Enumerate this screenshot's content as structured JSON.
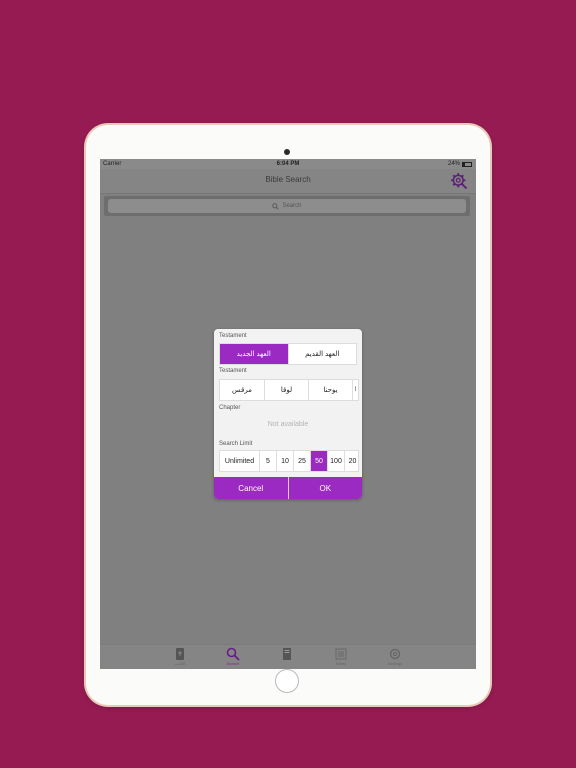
{
  "status": {
    "carrier": "Carrier",
    "time": "6:04 PM",
    "battery": "24%"
  },
  "header": {
    "title": "Bible Search"
  },
  "search": {
    "placeholder": "Search"
  },
  "tabs": [
    {
      "label": "الكتاب",
      "icon": "bible-icon",
      "active": false
    },
    {
      "label": "Search",
      "icon": "search-icon",
      "active": true
    },
    {
      "label": "",
      "icon": "bookmark-icon",
      "active": false
    },
    {
      "label": "Notes",
      "icon": "notes-icon",
      "active": false
    },
    {
      "label": "Settings",
      "icon": "settings-icon",
      "active": false
    }
  ],
  "dialog": {
    "testament_label": "Testament",
    "testament_options": [
      "العهد الجديد",
      "العهد القديم"
    ],
    "testament_selected": "العهد الجديد",
    "book_label": "Testament",
    "book_options": [
      "مرقس",
      "لوقا",
      "يوحنا",
      "أ"
    ],
    "chapter_label": "Chapter",
    "chapter_value": "Not available",
    "limit_label": "Search Limit",
    "limit_options": [
      "Unlimited",
      "5",
      "10",
      "25",
      "50",
      "100",
      "20"
    ],
    "limit_selected": "50",
    "cancel": "Cancel",
    "ok": "OK"
  },
  "colors": {
    "background": "#951b52",
    "accent": "#9b2ac2",
    "overlay": "#808080"
  }
}
